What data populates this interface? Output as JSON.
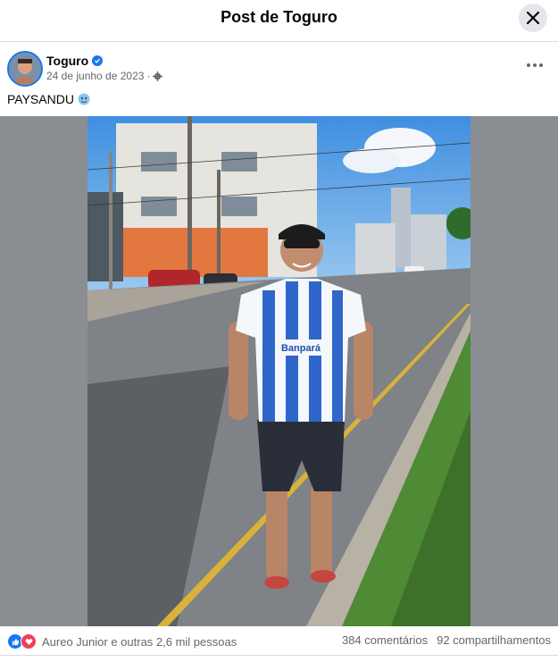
{
  "dialog": {
    "title": "Post de Toguro"
  },
  "post": {
    "author": "Toguro",
    "date": "24 de junho de 2023",
    "separator": "·",
    "caption": "PAYSANDU"
  },
  "photo": {
    "jersey_sponsor": "Banpará"
  },
  "footer": {
    "reactions_text": "Aureo Junior e outras 2,6 mil pessoas",
    "comments": "384 comentários",
    "shares": "92 compartilhamentos"
  },
  "colors": {
    "accent": "#1877f2",
    "like": "#1877f2",
    "love": "#f33e58"
  },
  "icons": [
    "close-icon",
    "verified-icon",
    "globe-icon",
    "more-icon",
    "emoji-icon",
    "like-icon",
    "love-icon"
  ]
}
